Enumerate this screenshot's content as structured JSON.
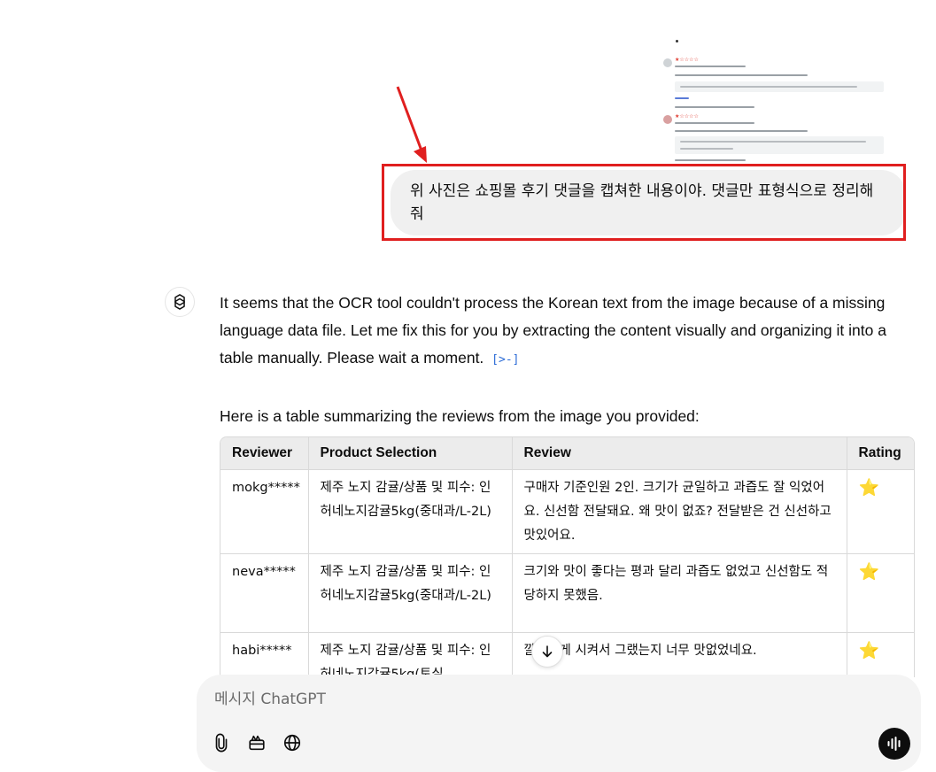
{
  "user_message": {
    "text": "위 사진은 쇼핑몰 후기 댓글을 캡쳐한 내용이야. 댓글만 표형식으로 정리해줘"
  },
  "assistant": {
    "paragraph1": "It seems that the OCR tool couldn't process the Korean text from the image because of a missing language data file. Let me fix this for you by extracting the content visually and organizing it into a table manually. Please wait a moment.",
    "citation_icon": "[>-]",
    "paragraph2": "Here is a table summarizing the reviews from the image you provided:",
    "table": {
      "headers": [
        "Reviewer",
        "Product Selection",
        "Review",
        "Rating"
      ],
      "rows": [
        {
          "reviewer": "mokg*****",
          "product": "제주 노지 감귤/상품 및 피수: 인허네노지감귤5kg(중대과/L-2L)",
          "review": "구매자 기준인원 2인. 크기가 균일하고 과즙도 잘 익었어요. 신선함 전달돼요. 왜 맛이 없죠? 전달받은 건 신선하고 맛있어요.",
          "rating": "⭐"
        },
        {
          "reviewer": "neva*****",
          "product": "제주 노지 감귤/상품 및 피수: 인허네노지감귤5kg(중대과/L-2L)",
          "review": "크기와 맛이 좋다는 평과 달리 과즙도 없었고 신선함도 적당하지 못했음.",
          "rating": "⭐"
        },
        {
          "reviewer": "habi*****",
          "product": "제주 노지 감귤/상품 및 피수: 인허네노지감귤5kg(토실",
          "review": "깔끔하게 시켜서 그랬는지 너무 맛없었네요.",
          "rating": "⭐"
        }
      ]
    }
  },
  "composer": {
    "placeholder": "메시지 ChatGPT"
  },
  "colors": {
    "annotation_red": "#e01f1f",
    "bubble_bg": "#f0f0f0",
    "composer_bg": "#f4f4f4",
    "citation_blue": "#2b6bd6"
  }
}
